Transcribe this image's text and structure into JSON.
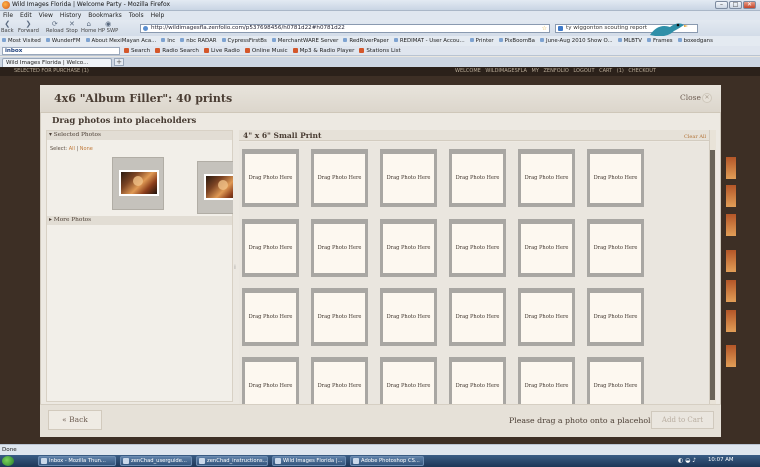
{
  "browser": {
    "window_title": "Wild Images Florida | Welcome Party - Mozilla Firefox",
    "menu": [
      "File",
      "Edit",
      "View",
      "History",
      "Bookmarks",
      "Tools",
      "Help"
    ],
    "nav": {
      "back": "Back",
      "forward": "Forward",
      "reload": "Reload",
      "stop": "Stop",
      "home": "Home",
      "hp_swp": "HP SWP"
    },
    "url": "http://wildimagesfla.zenfolio.com/p537698456/h0781d22#h0781d22",
    "search": "ty wiggonton scouting report",
    "bookmarks": [
      "Most Visited",
      "WunderFM",
      "About MexiMayan Aca...",
      "Inc",
      "nbc RADAR",
      "CypressFirstBs",
      "MerchantWARE Server",
      "RedRiverPaper",
      "REDIMAT - User Accou...",
      "Printer",
      "PixBoomBa",
      "June-Aug 2010 Show O...",
      "MLBTV",
      "Frames",
      "boxedgans"
    ],
    "inbox_label": "inbox",
    "toolbar2": [
      "Search",
      "Radio Search",
      "Live Radio",
      "Online Music",
      "Mp3 & Radio Player",
      "Stations List"
    ],
    "tab_label": "Wild Images Florida | Welco...",
    "new_tab": "+",
    "status": "Done"
  },
  "site_header": {
    "left": "SELECTED FOR PURCHASE (1)",
    "right": "WELCOME WILDIMAGESFLA  MY ZENFOLIO  LOGOUT  CART (1)  CHECKOUT"
  },
  "modal": {
    "title": "4x6 \"Album Filler\": 40 prints",
    "close_label": "Close",
    "subhead": "Drag photos into placeholders",
    "selected_photos_label": "▾ Selected Photos",
    "select_prefix": "Select:",
    "select_all": "All",
    "select_sep": "|",
    "select_none": "None",
    "more_photos_label": "▸ More Photos",
    "print_title": "4\" x 6\" Small Print",
    "clear_all": "Clear All",
    "placeholder_text": "Drag Photo Here",
    "back_label": "« Back",
    "drag_hint": "Please drag a photo onto a placeholder",
    "add_to_cart": "Add to Cart"
  },
  "placeholders": [
    "Drag Photo Here",
    "Drag Photo Here",
    "Drag Photo Here",
    "Drag Photo Here",
    "Drag Photo Here",
    "Drag Photo Here",
    "Drag Photo Here",
    "Drag Photo Here",
    "Drag Photo Here",
    "Drag Photo Here",
    "Drag Photo Here",
    "Drag Photo Here",
    "Drag Photo Here",
    "Drag Photo Here",
    "Drag Photo Here",
    "Drag Photo Here",
    "Drag Photo Here",
    "Drag Photo Here",
    "Drag Photo Here",
    "Drag Photo Here",
    "Drag Photo Here",
    "Drag Photo Here",
    "Drag Photo Here",
    "Drag Photo Here"
  ],
  "taskbar": {
    "tasks": [
      "Inbox - Mozilla Thun...",
      "zenChad_userguide...",
      "zenChad_instructions...",
      "Wild Images Florida |...",
      "Adobe Photoshop CS..."
    ],
    "clock": "10:07 AM"
  },
  "colors": {
    "accent": "#c07a3a",
    "modal_bg": "#ede9e2",
    "site_bg": "#3d2f25"
  }
}
